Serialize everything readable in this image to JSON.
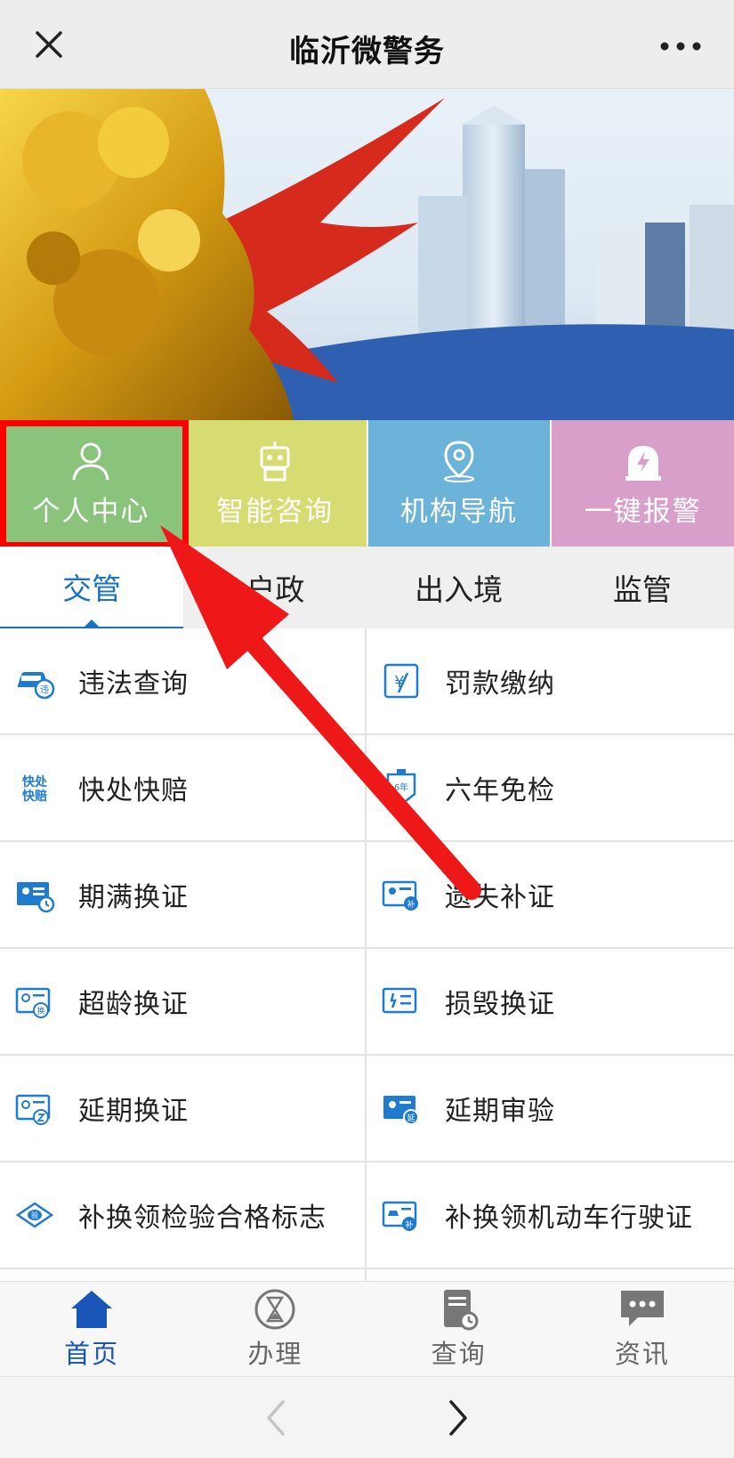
{
  "titlebar": {
    "title": "临沂微警务",
    "close_icon": "close-icon",
    "more_icon": "more-dots-icon"
  },
  "banner": {
    "description_icon": "city-banner"
  },
  "tiles": [
    {
      "label": "个人中心",
      "icon": "user-icon",
      "color": "#8ac47c"
    },
    {
      "label": "智能咨询",
      "icon": "robot-icon",
      "color": "#d7dc72"
    },
    {
      "label": "机构导航",
      "icon": "location-pin-icon",
      "color": "#6bb3d8"
    },
    {
      "label": "一键报警",
      "icon": "alarm-icon",
      "color": "#d89fca"
    }
  ],
  "category_tabs": [
    {
      "label": "交管",
      "active": true
    },
    {
      "label": "户政",
      "active": false
    },
    {
      "label": "出入境",
      "active": false
    },
    {
      "label": "监管",
      "active": false
    }
  ],
  "services": [
    {
      "label": "违法查询",
      "icon": "car-violation-icon"
    },
    {
      "label": "罚款缴纳",
      "icon": "fine-payment-icon"
    },
    {
      "label": "快处快赔",
      "icon": "quick-claim-icon"
    },
    {
      "label": "六年免检",
      "icon": "inspection-exempt-icon"
    },
    {
      "label": "期满换证",
      "icon": "license-expire-icon"
    },
    {
      "label": "遗失补证",
      "icon": "license-reissue-icon"
    },
    {
      "label": "超龄换证",
      "icon": "license-age-icon"
    },
    {
      "label": "损毁换证",
      "icon": "license-damaged-icon"
    },
    {
      "label": "延期换证",
      "icon": "license-postpone-icon"
    },
    {
      "label": "延期审验",
      "icon": "review-postpone-icon"
    },
    {
      "label": "补换领检验合格标志",
      "icon": "inspection-mark-icon"
    },
    {
      "label": "补换领机动车行驶证",
      "icon": "vehicle-license-icon"
    }
  ],
  "bottom_nav": [
    {
      "label": "首页",
      "icon": "home-icon",
      "active": true
    },
    {
      "label": "办理",
      "icon": "hourglass-icon",
      "active": false
    },
    {
      "label": "查询",
      "icon": "document-search-icon",
      "active": false
    },
    {
      "label": "资讯",
      "icon": "chat-icon",
      "active": false
    }
  ],
  "browser_bar": {
    "back_icon": "chevron-left-icon",
    "forward_icon": "chevron-right-icon"
  },
  "colors": {
    "accent_blue": "#1a73c0",
    "highlight_red": "#ff0000",
    "nav_active": "#1a55b8"
  }
}
